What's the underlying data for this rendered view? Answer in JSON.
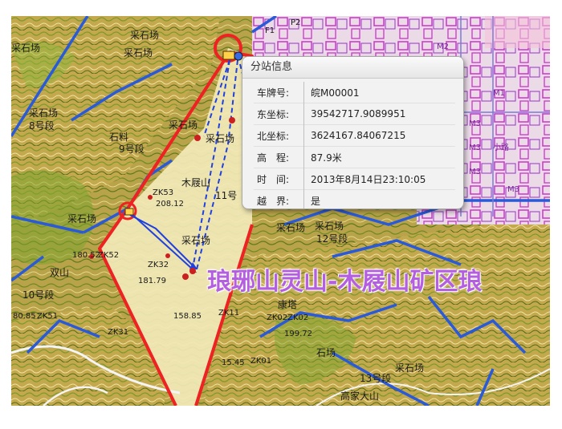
{
  "popup": {
    "title": "分站信息",
    "rows": [
      {
        "key": "车牌号:",
        "value": "皖M00001"
      },
      {
        "key": "东坐标:",
        "value": "39542717.9089951"
      },
      {
        "key": "北坐标:",
        "value": "3624167.84067215"
      },
      {
        "key": "高　程:",
        "value": "87.9米"
      },
      {
        "key": "时　间:",
        "value": "2013年8月14日23:10:05"
      },
      {
        "key": "越　界:",
        "value": "是"
      }
    ]
  },
  "banner": "琅琊山灵山-木屐山矿区琅",
  "labels": [
    {
      "name": "label-quarry-1",
      "text": "采石场"
    },
    {
      "name": "label-quarry-2",
      "text": "采石场"
    },
    {
      "name": "label-quarry-3",
      "text": "采石场"
    },
    {
      "name": "label-quarry-4",
      "text": "采石场"
    },
    {
      "name": "label-quarry-5",
      "text": "采石场"
    },
    {
      "name": "label-quarry-6",
      "text": "采石场"
    },
    {
      "name": "label-quarry-7",
      "text": "采石场"
    },
    {
      "name": "label-quarry-8",
      "text": "采石场"
    },
    {
      "name": "label-quarry-9",
      "text": "采石场"
    },
    {
      "name": "label-quarry-10",
      "text": "采石场"
    },
    {
      "name": "label-quarry-11",
      "text": "采石场"
    },
    {
      "name": "label-no8",
      "text": "8号段"
    },
    {
      "name": "label-no9",
      "text": "9号段"
    },
    {
      "name": "label-no10",
      "text": "10号段"
    },
    {
      "name": "label-no11",
      "text": "11号"
    },
    {
      "name": "label-no12",
      "text": "12号段"
    },
    {
      "name": "label-no13",
      "text": "13号段"
    },
    {
      "name": "label-shikeng",
      "text": "石料"
    },
    {
      "name": "label-mujishan",
      "text": "木屐山"
    },
    {
      "name": "label-zk53",
      "text": "ZK53"
    },
    {
      "name": "label-elev-208",
      "text": "208.12"
    },
    {
      "name": "label-zk52",
      "text": "ZK52"
    },
    {
      "name": "label-elev-180",
      "text": "180.52"
    },
    {
      "name": "label-zk32",
      "text": "ZK32"
    },
    {
      "name": "label-elev-181",
      "text": "181.79"
    },
    {
      "name": "label-zk11",
      "text": "ZK11"
    },
    {
      "name": "label-elev-158",
      "text": "158.85"
    },
    {
      "name": "label-zk51",
      "text": "ZK51"
    },
    {
      "name": "label-elev-80",
      "text": "80.85"
    },
    {
      "name": "label-zk31",
      "text": "ZK31"
    },
    {
      "name": "label-zk01",
      "text": "ZK01"
    },
    {
      "name": "label-elev-15",
      "text": "15.45"
    },
    {
      "name": "label-zk02",
      "text": "ZK02ZK02"
    },
    {
      "name": "label-elev-199",
      "text": "199.72"
    },
    {
      "name": "label-gaojiadashan",
      "text": "高家大山"
    },
    {
      "name": "label-shuangshan",
      "text": "双山"
    },
    {
      "name": "label-kangta",
      "text": "康塔"
    },
    {
      "name": "label-shichang",
      "text": "石场"
    },
    {
      "name": "label-m3a",
      "text": "M3"
    },
    {
      "name": "label-m3b",
      "text": "M3"
    },
    {
      "name": "label-m3c",
      "text": "M3"
    },
    {
      "name": "label-m3d",
      "text": "M3"
    },
    {
      "name": "label-m1",
      "text": "M1"
    },
    {
      "name": "label-m2",
      "text": "M2"
    },
    {
      "name": "label-p2",
      "text": "P2"
    },
    {
      "name": "label-f1",
      "text": "F1"
    },
    {
      "name": "label-xiaolu",
      "text": "小路"
    }
  ]
}
